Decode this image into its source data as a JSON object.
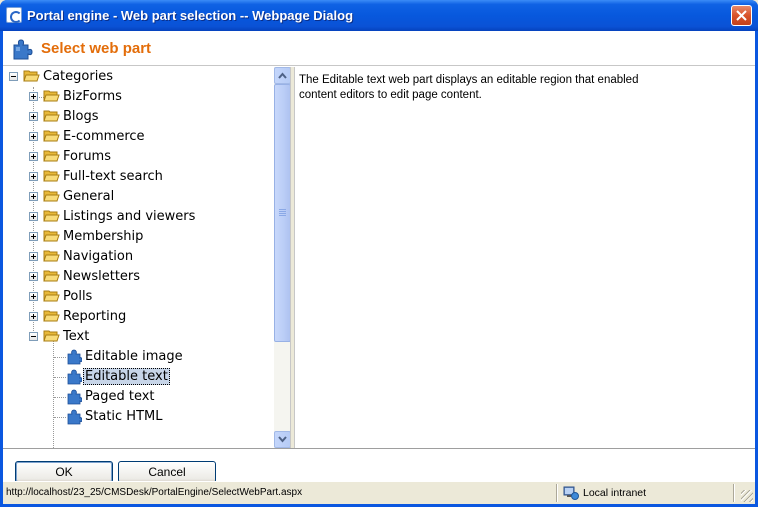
{
  "window": {
    "title": "Portal engine - Web part selection -- Webpage Dialog"
  },
  "header": {
    "title": "Select web part"
  },
  "tree": {
    "root": "Categories",
    "categories": [
      "BizForms",
      "Blogs",
      "E-commerce",
      "Forums",
      "Full-text search",
      "General",
      "Listings and viewers",
      "Membership",
      "Navigation",
      "Newsletters",
      "Polls",
      "Reporting",
      "Text"
    ],
    "text_children": [
      "Editable image",
      "Editable text",
      "Paged text",
      "Static HTML"
    ],
    "selected": "Editable text"
  },
  "description": {
    "text": "The Editable text web part displays an editable region that enabled content editors to edit page content."
  },
  "buttons": {
    "ok": "OK",
    "cancel": "Cancel"
  },
  "status": {
    "url": "http://localhost/23_25/CMSDesk/PortalEngine/SelectWebPart.aspx",
    "zone": "Local intranet"
  },
  "colors": {
    "titlebar": "#0a57e0",
    "header_title": "#e36d0a",
    "selection": "#c7d5e8"
  }
}
